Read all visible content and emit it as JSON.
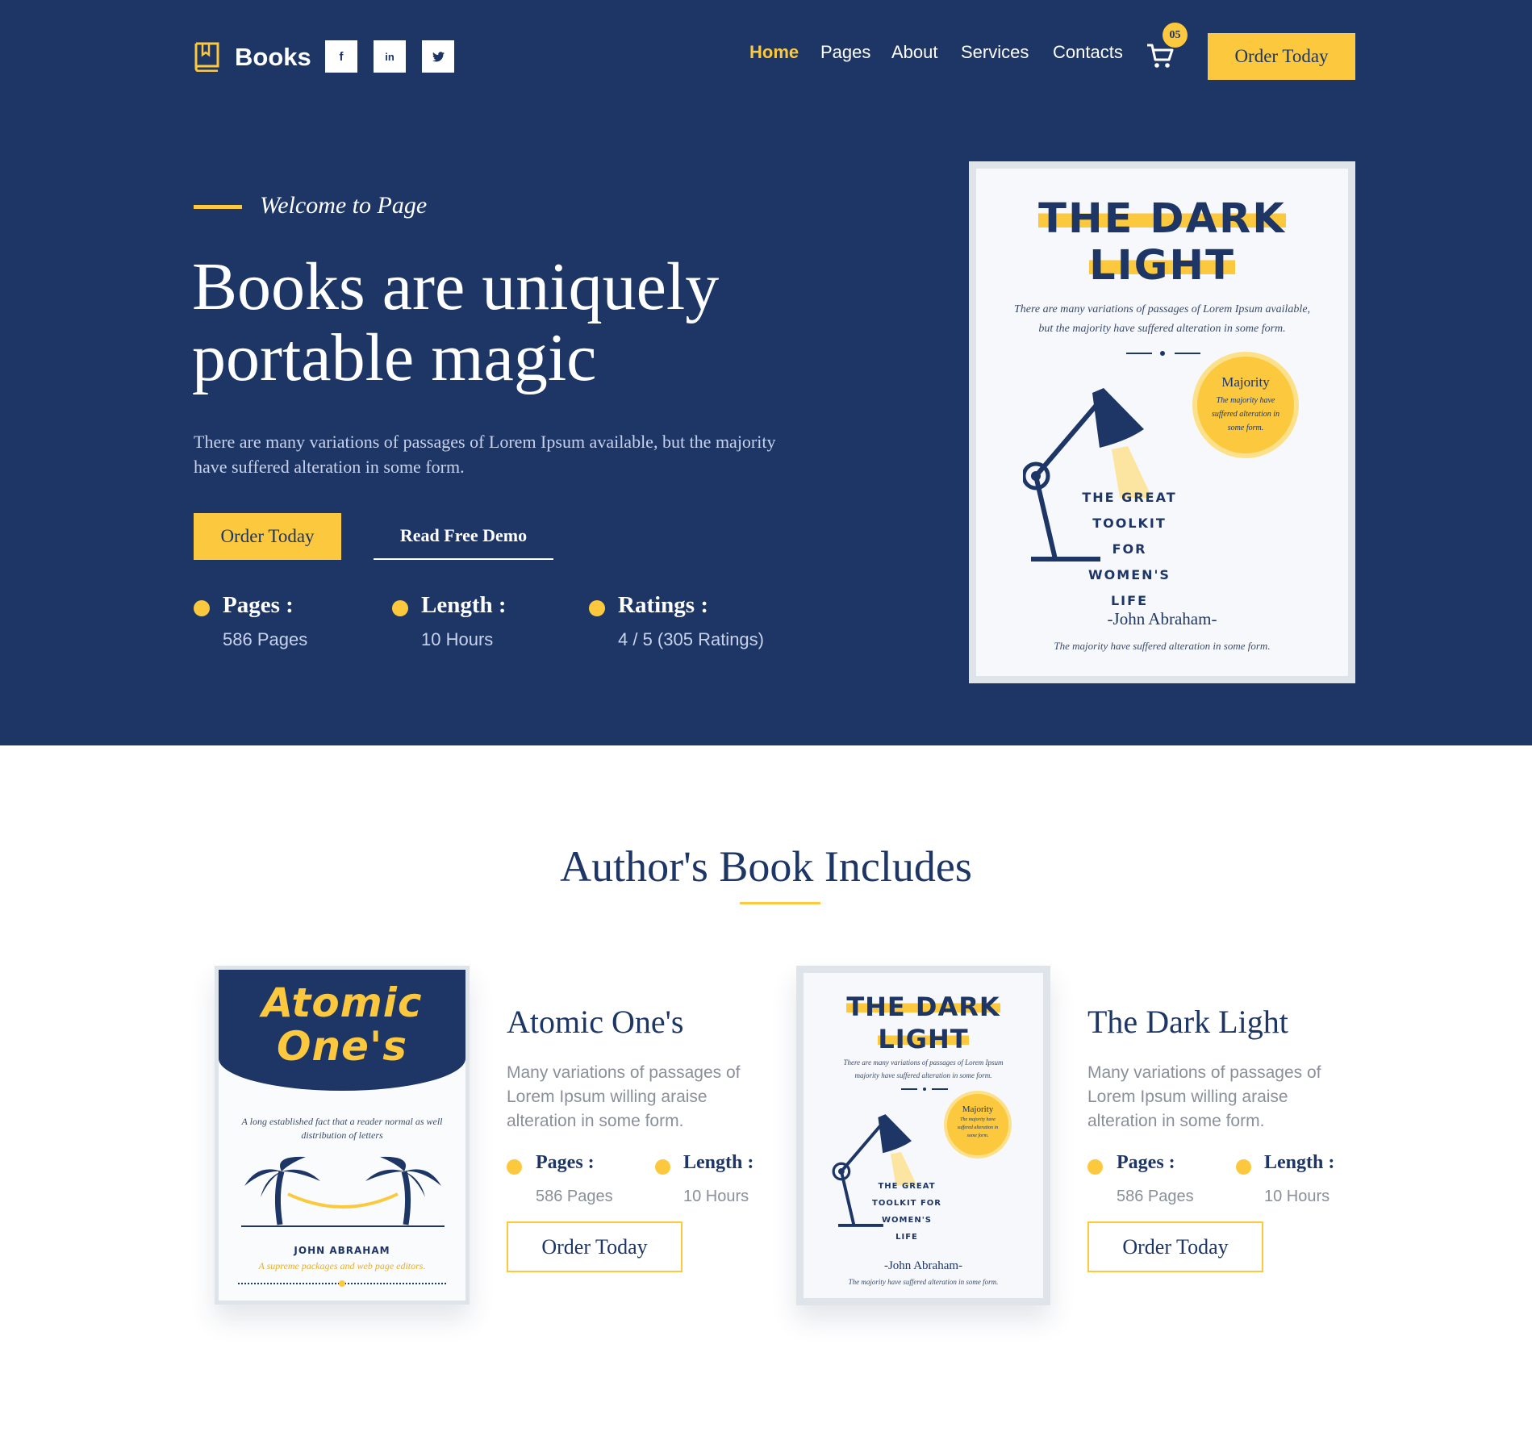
{
  "header": {
    "brand": "Books",
    "socials": [
      {
        "icon": "facebook-icon",
        "glyph": "f"
      },
      {
        "icon": "linkedin-icon",
        "glyph": "in"
      },
      {
        "icon": "twitter-icon",
        "glyph": "✦"
      }
    ],
    "nav": [
      {
        "label": "Home",
        "active": true
      },
      {
        "label": "Pages",
        "active": false
      },
      {
        "label": "About",
        "active": false
      },
      {
        "label": "Services",
        "active": false
      },
      {
        "label": "Contacts",
        "active": false
      }
    ],
    "cart_count": "05",
    "order_label": "Order Today"
  },
  "hero": {
    "welcome": "Welcome to Page",
    "title_line1": "Books are uniquely",
    "title_line2": "portable magic",
    "description": "There are many variations of passages of Lorem Ipsum available, but the majority have suffered alteration in some form.",
    "order_label": "Order Today",
    "demo_label": "Read Free Demo",
    "stats": [
      {
        "label": "Pages :",
        "value": "586 Pages"
      },
      {
        "label": "Length :",
        "value": "10 Hours"
      },
      {
        "label": "Ratings :",
        "value": "4 / 5 (305 Ratings)"
      }
    ]
  },
  "dark_cover": {
    "title_line1": "THE DARK",
    "title_line2": "LIGHT",
    "tagline": "There are many variations of passages of Lorem Ipsum available, but the majority have suffered alteration in some form.",
    "badge_title": "Majority",
    "badge_text": "The majority have suffered alteration in some form.",
    "subtitle": [
      "THE GREAT",
      "TOOLKIT FOR",
      "WOMEN'S",
      "LIFE"
    ],
    "author": "-John Abraham-",
    "footer": "The majority have suffered alteration in some form."
  },
  "small_dark_cover": {
    "tagline": "There are many variations of passages of Lorem Ipsum majority have suffered alteration in some form."
  },
  "atomic_cover": {
    "title_line1": "Atomic",
    "title_line2": "One's",
    "tagline": "A long established fact that a reader normal as well distribution of letters",
    "author": "JOHN ABRAHAM",
    "footer": "A supreme packages and web page editors."
  },
  "section": {
    "title": "Author's Book Includes"
  },
  "books": [
    {
      "title": "Atomic One's",
      "description": "Many variations of passages of Lorem Ipsum willing araise alteration in some form.",
      "stats": [
        {
          "label": "Pages :",
          "value": "586 Pages"
        },
        {
          "label": "Length :",
          "value": "10 Hours"
        }
      ],
      "order_label": "Order Today"
    },
    {
      "title": "The Dark Light",
      "description": "Many variations of passages of Lorem Ipsum willing araise alteration in some form.",
      "stats": [
        {
          "label": "Pages :",
          "value": "586 Pages"
        },
        {
          "label": "Length :",
          "value": "10 Hours"
        }
      ],
      "order_label": "Order Today"
    }
  ],
  "colors": {
    "navy": "#1d3666",
    "accent": "#fcc83d",
    "muted_text": "#8a8f99"
  }
}
